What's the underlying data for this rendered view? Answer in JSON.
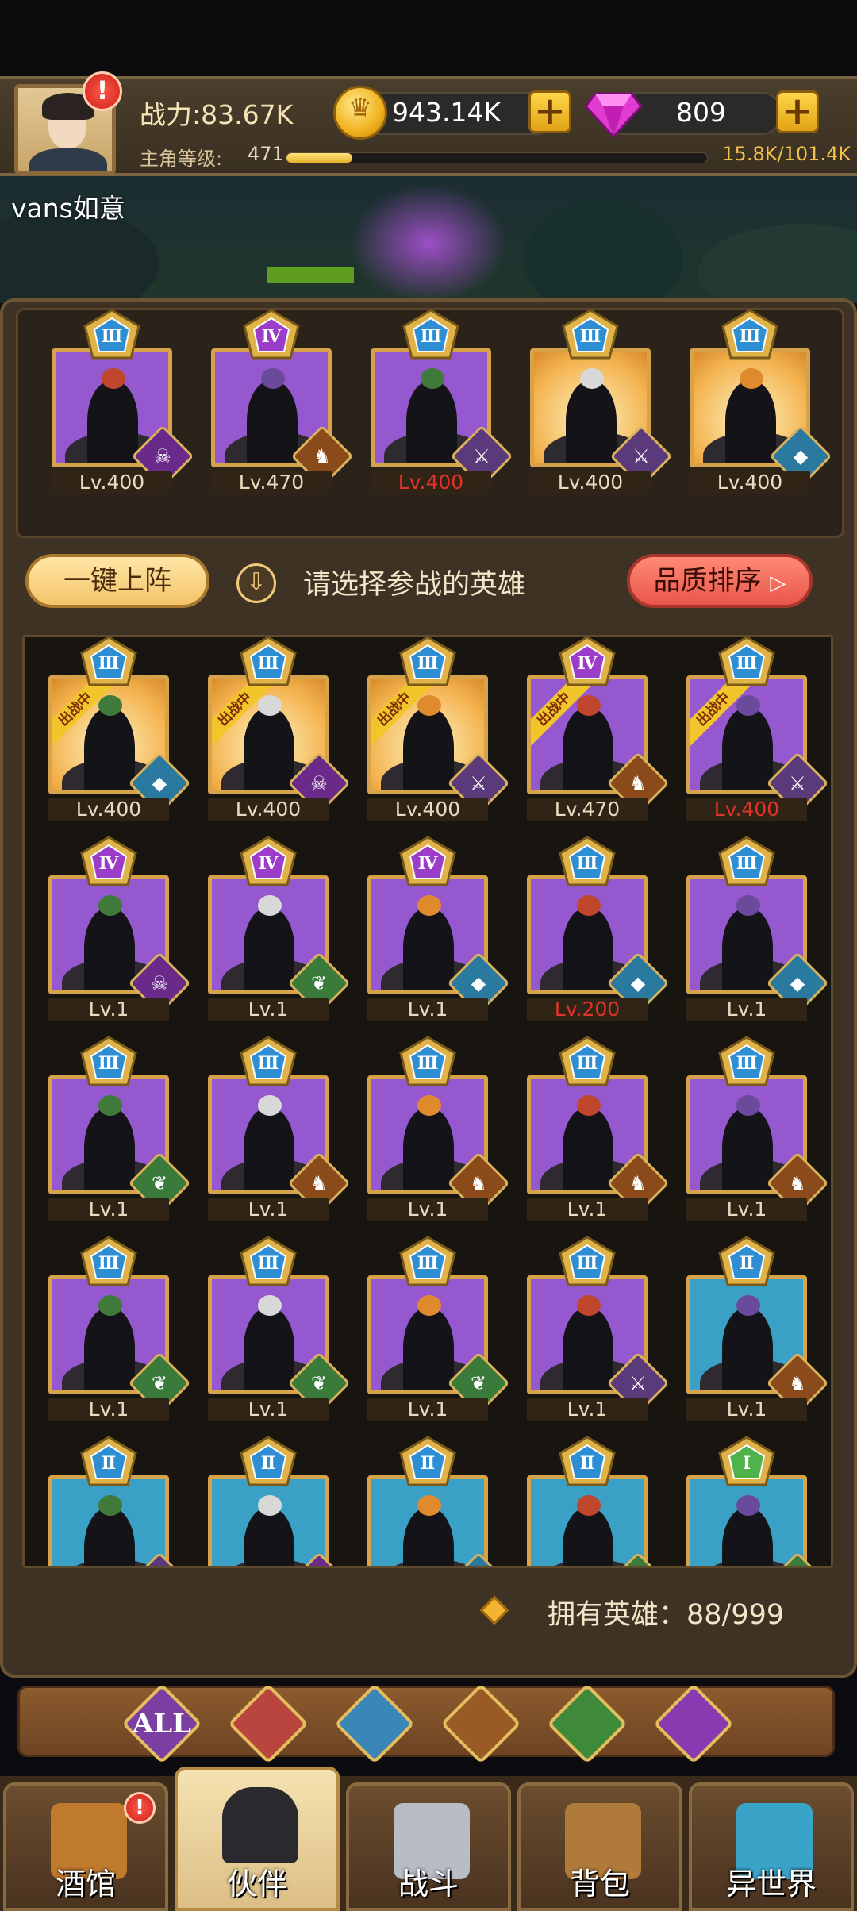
{
  "header": {
    "power_text": "战力:83.67K",
    "level_label": "主角等级:",
    "level_value": "471",
    "xp_text": "15.8K/101.4K",
    "xp_fraction": 0.156,
    "gold": "943.14K",
    "gems": "809",
    "alert_mark": "!"
  },
  "player": {
    "name": "vans如意"
  },
  "lineup": [
    {
      "tier": "Ⅲ",
      "level": "Lv.400",
      "bg": "purple",
      "faction": "demon",
      "red": false
    },
    {
      "tier": "Ⅳ",
      "level": "Lv.470",
      "bg": "purple",
      "faction": "beast",
      "red": false
    },
    {
      "tier": "Ⅲ",
      "level": "Lv.400",
      "bg": "purple",
      "faction": "human",
      "red": true
    },
    {
      "tier": "Ⅲ",
      "level": "Lv.400",
      "bg": "gold",
      "faction": "human",
      "red": false
    },
    {
      "tier": "Ⅲ",
      "level": "Lv.400",
      "bg": "gold",
      "faction": "naga",
      "red": false
    }
  ],
  "actions": {
    "auto_lineup": "一键上阵",
    "prompt": "请选择参战的英雄",
    "sort": "品质排序"
  },
  "deployed_label": "出战中",
  "heroes": [
    {
      "tier": "Ⅲ",
      "level": "Lv.400",
      "bg": "gold",
      "faction": "naga",
      "deployed": true,
      "red": false
    },
    {
      "tier": "Ⅲ",
      "level": "Lv.400",
      "bg": "gold",
      "faction": "demon",
      "deployed": true,
      "red": false
    },
    {
      "tier": "Ⅲ",
      "level": "Lv.400",
      "bg": "gold",
      "faction": "human",
      "deployed": true,
      "red": false
    },
    {
      "tier": "Ⅳ",
      "level": "Lv.470",
      "bg": "purple",
      "faction": "beast",
      "deployed": true,
      "red": false
    },
    {
      "tier": "Ⅲ",
      "level": "Lv.400",
      "bg": "purple",
      "faction": "human",
      "deployed": true,
      "red": true
    },
    {
      "tier": "Ⅳ",
      "level": "Lv.1",
      "bg": "purple",
      "faction": "demon",
      "deployed": false,
      "red": false
    },
    {
      "tier": "Ⅳ",
      "level": "Lv.1",
      "bg": "purple",
      "faction": "elf",
      "deployed": false,
      "red": false
    },
    {
      "tier": "Ⅳ",
      "level": "Lv.1",
      "bg": "purple",
      "faction": "naga",
      "deployed": false,
      "red": false
    },
    {
      "tier": "Ⅲ",
      "level": "Lv.200",
      "bg": "purple",
      "faction": "naga",
      "deployed": false,
      "red": true
    },
    {
      "tier": "Ⅲ",
      "level": "Lv.1",
      "bg": "purple",
      "faction": "naga",
      "deployed": false,
      "red": false
    },
    {
      "tier": "Ⅲ",
      "level": "Lv.1",
      "bg": "purple",
      "faction": "elf",
      "deployed": false,
      "red": false
    },
    {
      "tier": "Ⅲ",
      "level": "Lv.1",
      "bg": "purple",
      "faction": "beast",
      "deployed": false,
      "red": false
    },
    {
      "tier": "Ⅲ",
      "level": "Lv.1",
      "bg": "purple",
      "faction": "beast",
      "deployed": false,
      "red": false
    },
    {
      "tier": "Ⅲ",
      "level": "Lv.1",
      "bg": "purple",
      "faction": "beast",
      "deployed": false,
      "red": false
    },
    {
      "tier": "Ⅲ",
      "level": "Lv.1",
      "bg": "purple",
      "faction": "beast",
      "deployed": false,
      "red": false
    },
    {
      "tier": "Ⅲ",
      "level": "Lv.1",
      "bg": "purple",
      "faction": "elf",
      "deployed": false,
      "red": false
    },
    {
      "tier": "Ⅲ",
      "level": "Lv.1",
      "bg": "purple",
      "faction": "elf",
      "deployed": false,
      "red": false
    },
    {
      "tier": "Ⅲ",
      "level": "Lv.1",
      "bg": "purple",
      "faction": "elf",
      "deployed": false,
      "red": false
    },
    {
      "tier": "Ⅲ",
      "level": "Lv.1",
      "bg": "purple",
      "faction": "human",
      "deployed": false,
      "red": false
    },
    {
      "tier": "Ⅱ",
      "level": "Lv.1",
      "bg": "blue",
      "faction": "beast",
      "deployed": false,
      "red": false
    },
    {
      "tier": "Ⅱ",
      "level": "",
      "bg": "blue",
      "faction": "human",
      "deployed": false,
      "red": false
    },
    {
      "tier": "Ⅱ",
      "level": "",
      "bg": "blue",
      "faction": "demon",
      "deployed": false,
      "red": false
    },
    {
      "tier": "Ⅱ",
      "level": "",
      "bg": "blue",
      "faction": "naga",
      "deployed": false,
      "red": false
    },
    {
      "tier": "Ⅱ",
      "level": "",
      "bg": "blue",
      "faction": "elf",
      "deployed": false,
      "red": false
    },
    {
      "tier": "Ⅰ",
      "level": "",
      "bg": "blue",
      "faction": "elf",
      "deployed": false,
      "red": false
    }
  ],
  "owned": {
    "label": "拥有英雄：",
    "count": "88/999"
  },
  "filters": [
    {
      "id": "all",
      "label": "ALL",
      "color": "#7a3fa0",
      "icon": "all-icon"
    },
    {
      "id": "human",
      "label": "",
      "color": "#b8463e",
      "icon": "human-faction-icon"
    },
    {
      "id": "naga",
      "label": "",
      "color": "#3a86b6",
      "icon": "naga-faction-icon"
    },
    {
      "id": "beast",
      "label": "",
      "color": "#9a5a25",
      "icon": "beast-faction-icon"
    },
    {
      "id": "elf",
      "label": "",
      "color": "#3e8a3a",
      "icon": "elf-faction-icon"
    },
    {
      "id": "demon",
      "label": "",
      "color": "#8a3ab0",
      "icon": "demon-faction-icon"
    }
  ],
  "nav": [
    {
      "label": "酒馆",
      "icon": "tavern-mug-icon",
      "alert": true,
      "active": false
    },
    {
      "label": "伙伴",
      "icon": "partner-silhouette-icon",
      "alert": false,
      "active": true
    },
    {
      "label": "战斗",
      "icon": "crossed-swords-icon",
      "alert": false,
      "active": false
    },
    {
      "label": "背包",
      "icon": "backpack-chest-icon",
      "alert": false,
      "active": false
    },
    {
      "label": "异世界",
      "icon": "portal-gate-icon",
      "alert": false,
      "active": false
    }
  ],
  "colors": {
    "tier_bg": {
      "Ⅰ": "#4fb34a",
      "Ⅱ": "#2e8ed4",
      "Ⅲ": "#2e8ed4",
      "Ⅳ": "#9b3dc9"
    },
    "faction_bg": {
      "human": "#5a3a7a",
      "naga": "#2a7aa0",
      "beast": "#8a4a1a",
      "elf": "#3a7a3a",
      "demon": "#6a2a8a"
    },
    "faction_glyph": {
      "human": "⚔",
      "naga": "◆",
      "beast": "♞",
      "elf": "❦",
      "demon": "☠"
    }
  }
}
